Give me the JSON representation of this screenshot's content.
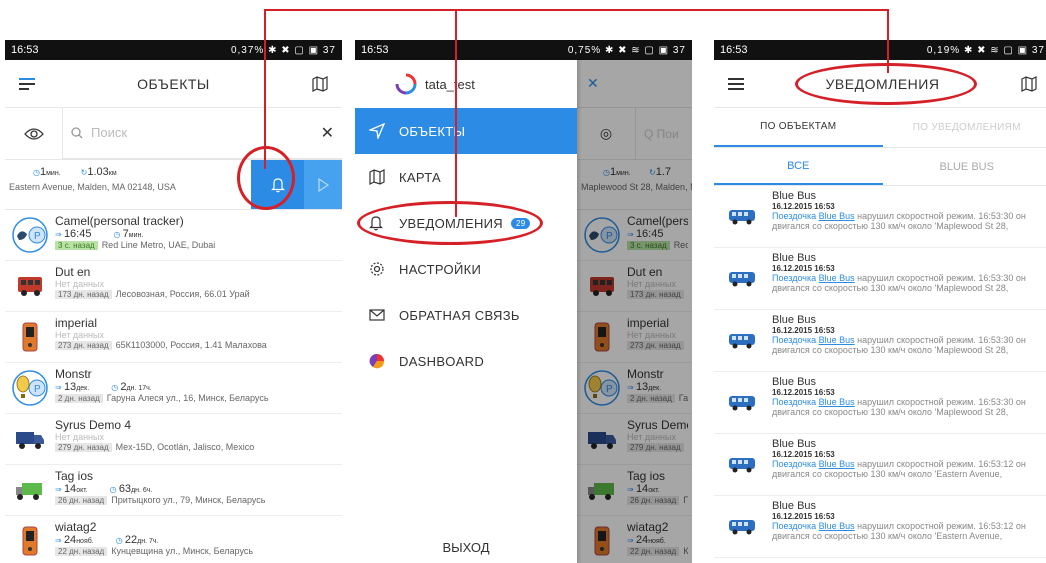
{
  "colors": {
    "accent": "#2c8ce5",
    "annotation": "#d62027",
    "green_tag": "#b9e3a6"
  },
  "screen1": {
    "status": {
      "time": "16:53",
      "right": "0,37% ✱ ✖ ▢ ▣ 37"
    },
    "title": "ОБЪЕКТЫ",
    "search_placeholder": "Поиск",
    "summary": {
      "time_val": "1",
      "time_unit": "мин.",
      "dist_val": "1.03",
      "dist_unit": "км",
      "address": "Eastern Avenue, Malden, MA 02148, USA"
    },
    "objects": [
      {
        "name": "Camel(personal tracker)",
        "line1": "16:45",
        "line1b": "7",
        "line1b_unit": "мин.",
        "tag": "3 с. назад",
        "tag_green": true,
        "addr": "Red Line Metro, UAE, Dubai",
        "icon": "personal-tracker-icon"
      },
      {
        "name": "Dut en",
        "sub": "Нет данных",
        "tag": "173 дн. назад",
        "addr": "Лесовозная, Россия, 66.01  Урай",
        "icon": "bus-icon"
      },
      {
        "name": "imperial",
        "sub": "Нет данных",
        "tag": "273 дн. назад",
        "addr": "65К1103000, Россия, 1.41  Малахова",
        "icon": "phone-device-icon"
      },
      {
        "name": "Monstr",
        "line1": "13",
        "line1_unit": "дек.",
        "line1b": "2",
        "line1b_unit": "дн. 17ч.",
        "tag": "2 дн. назад",
        "addr": "Гаруна Алеся ул., 16, Минск, Беларусь",
        "icon": "balloon-icon"
      },
      {
        "name": "Syrus Demo 4",
        "sub": "Нет данных",
        "tag": "279 дн. назад",
        "addr": "Mex-15D, Ocotlán, Jalisco, Mexico",
        "icon": "truck-icon"
      },
      {
        "name": "Tag ios",
        "line1": "14",
        "line1_unit": "окт.",
        "line1b": "63",
        "line1b_unit": "дн. 6ч.",
        "tag": "26 дн. назад",
        "addr": "Притыцкого ул., 79, Минск, Беларусь",
        "icon": "green-truck-icon"
      },
      {
        "name": "wiatag2",
        "line1": "24",
        "line1_unit": "нояб.",
        "line1b": "22",
        "line1b_unit": "дн. 7ч.",
        "tag": "22 дн. назад",
        "addr": "Кунцевщина ул., Минск, Беларусь",
        "icon": "phone-device-icon"
      }
    ]
  },
  "screen2": {
    "status": {
      "time": "16:53",
      "right": "0,75% ✱ ✖ ≋ ▢ ▣ 37"
    },
    "account": "tata_test",
    "menu": [
      {
        "label": "ОБЪЕКТЫ",
        "icon": "navigation-arrow-icon",
        "active": true
      },
      {
        "label": "КАРТА",
        "icon": "map-icon"
      },
      {
        "label": "УВЕДОМЛЕНИЯ",
        "icon": "bell-icon",
        "badge": "29"
      },
      {
        "label": "НАСТРОЙКИ",
        "icon": "gear-icon"
      },
      {
        "label": "ОБРАТНАЯ СВЯЗЬ",
        "icon": "envelope-icon"
      },
      {
        "label": "DASHBOARD",
        "icon": "pie-chart-icon"
      }
    ],
    "logout": "ВЫХОД",
    "bg": {
      "search_placeholder": "Пои",
      "time_val": "1",
      "time_unit": "мин.",
      "dist_val": "1.7",
      "address": "Maplewood St 28, Malden, M",
      "objects": [
        {
          "name": "Camel(person",
          "line1": "16:45",
          "tag": "3 с. назад",
          "extra": "Red"
        },
        {
          "name": "Dut en",
          "sub": "Нет данных",
          "tag": "173 дн. назад"
        },
        {
          "name": "imperial",
          "sub": "Нет данных",
          "tag": "273 дн. назад"
        },
        {
          "name": "Monstr",
          "line1": "13",
          "line1_unit": "дек.",
          "tag": "2 дн. назад",
          "extra": "Гар"
        },
        {
          "name": "Syrus Demo 4",
          "sub": "Нет данных",
          "tag": "279 дн. назад"
        },
        {
          "name": "Tag ios",
          "line1": "14",
          "line1_unit": "окт.",
          "tag": "26 дн. назад",
          "extra": "П"
        },
        {
          "name": "wiatag2",
          "line1": "24",
          "line1_unit": "нояб.",
          "tag": "22 дн. назад",
          "extra": "Ку"
        }
      ]
    }
  },
  "screen3": {
    "status": {
      "time": "16:53",
      "right": "0,19% ✱ ✖ ≋ ▢ ▣ 37"
    },
    "title": "УВЕДОМЛЕНИЯ",
    "tabs": [
      "ПО ОБЪЕКТАМ",
      "ПО УВЕДОМЛЕНИЯМ"
    ],
    "subtabs": [
      "ВСЕ",
      "BLUE BUS"
    ],
    "notifications": [
      {
        "name": "Blue Bus",
        "date": "16.12.2015 16:53",
        "prefix": "Поездочка ",
        "link": "Blue Bus",
        "msg": " нарушил скоростной режим.  16:53:30 он",
        "line2": "двигался со скоростью 130 км/ч около 'Maplewood St 28,"
      },
      {
        "name": "Blue Bus",
        "date": "16.12.2015 16:53",
        "prefix": "Поездочка ",
        "link": "Blue Bus",
        "msg": " нарушил скоростной режим.  16:53:30 он",
        "line2": "двигался со скоростью 130 км/ч около 'Maplewood St 28,"
      },
      {
        "name": "Blue Bus",
        "date": "16.12.2015 16:53",
        "prefix": "Поездочка ",
        "link": "Blue Bus",
        "msg": " нарушил скоростной режим.  16:53:30 он",
        "line2": "двигался со скоростью 130 км/ч около 'Maplewood St 28,"
      },
      {
        "name": "Blue Bus",
        "date": "16.12.2015 16:53",
        "prefix": "Поездочка ",
        "link": "Blue Bus",
        "msg": " нарушил скоростной режим.  16:53:30 он",
        "line2": "двигался со скоростью 130 км/ч около 'Maplewood St 28,"
      },
      {
        "name": "Blue Bus",
        "date": "16.12.2015 16:53",
        "prefix": "Поездочка ",
        "link": "Blue Bus",
        "msg": " нарушил скоростной режим.  16:53:12 он",
        "line2": "двигался со скоростью 130 км/ч около 'Eastern Avenue,"
      },
      {
        "name": "Blue Bus",
        "date": "16.12.2015 16:53",
        "prefix": "Поездочка ",
        "link": "Blue Bus",
        "msg": " нарушил скоростной режим.  16:53:12 он",
        "line2": "двигался со скоростью 130 км/ч около 'Eastern Avenue,"
      }
    ]
  }
}
